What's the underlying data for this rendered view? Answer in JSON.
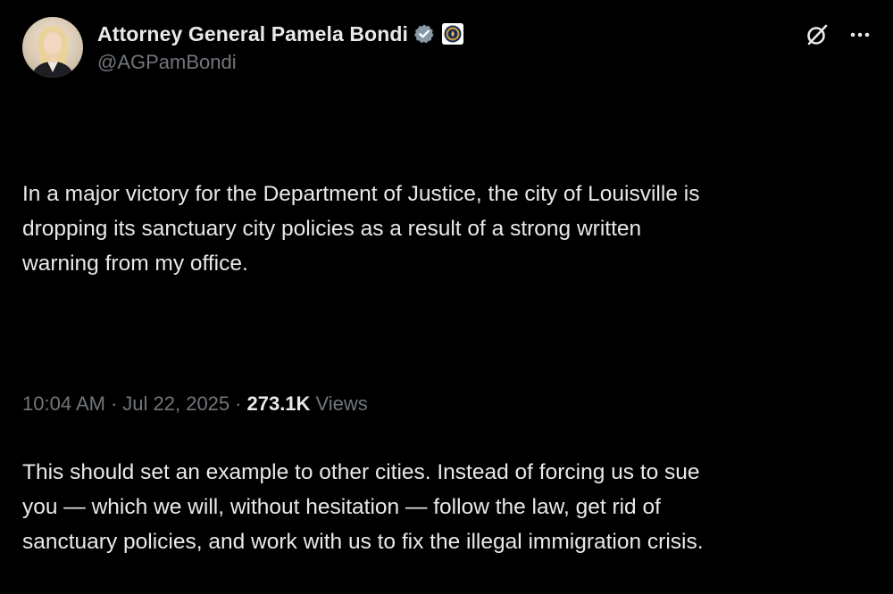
{
  "author": {
    "display_name": "Attorney General Pamela Bondi",
    "handle": "@AGPamBondi",
    "verified_badge_color": "#8899a6",
    "avatar_icon": "profile-photo"
  },
  "header_icons": {
    "grok": "grok-icon",
    "more": "more-icon"
  },
  "tweet": {
    "paragraph1_lines": [
      "In a major victory for the Department of Justice, the city of Louisville is",
      "dropping its sanctuary city policies as a result of a strong written",
      "warning from my office."
    ],
    "paragraph2_lines": [
      "This should set an example to other cities. Instead of forcing us to sue",
      "you — which we will, without hesitation — follow the law, get rid of",
      "sanctuary policies, and work with us to fix the illegal immigration crisis."
    ]
  },
  "meta": {
    "time": "10:04 AM",
    "separator": "·",
    "date": "Jul 22, 2025",
    "views_count": "273.1K",
    "views_label": "Views"
  },
  "colors": {
    "background": "#000000",
    "text": "#e7e9ea",
    "secondary": "#71767b"
  }
}
